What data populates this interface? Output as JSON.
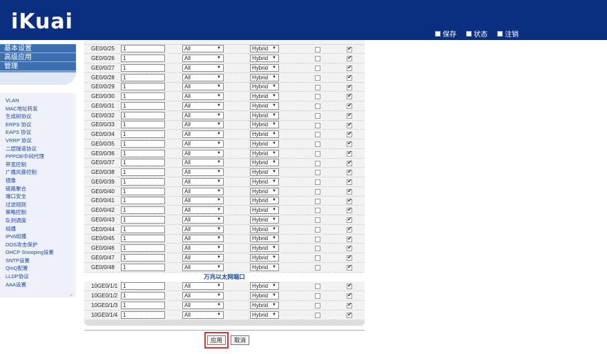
{
  "app": {
    "logo": "iKuai"
  },
  "toplinks": [
    {
      "label": "保存",
      "icon": "save-icon"
    },
    {
      "label": "状态",
      "icon": "status-icon"
    },
    {
      "label": "注销",
      "icon": "logout-icon"
    }
  ],
  "sidebar": {
    "top_menu": [
      "基本设置",
      "高级应用",
      "管理"
    ],
    "items": [
      "VLAN",
      "MAC地址转发",
      "生成树协议",
      "ERPS 协议",
      "EAPS 协议",
      "VRRP 协议",
      "二层隧道协议",
      "PPPOE中间代理",
      "带宽控制",
      "广播风暴控制",
      "镜像",
      "链路聚合",
      "端口安全",
      "过滤规则",
      "策略控制",
      "队列调度",
      "组播",
      "IPv6组播",
      "DOS攻击保护",
      "DHCP Snooping设置",
      "SNTP设置",
      "QinQ配置",
      "LLDP协议",
      "AAA设置"
    ]
  },
  "ports_ge": [
    {
      "name": "GE0/0/25",
      "vlan": "1",
      "allowed": "All",
      "mode": "Hybrid",
      "c1": false,
      "c2": true
    },
    {
      "name": "GE0/0/26",
      "vlan": "1",
      "allowed": "All",
      "mode": "Hybrid",
      "c1": false,
      "c2": true
    },
    {
      "name": "GE0/0/27",
      "vlan": "1",
      "allowed": "All",
      "mode": "Hybrid",
      "c1": false,
      "c2": true
    },
    {
      "name": "GE0/0/28",
      "vlan": "1",
      "allowed": "All",
      "mode": "Hybrid",
      "c1": false,
      "c2": true
    },
    {
      "name": "GE0/0/29",
      "vlan": "1",
      "allowed": "All",
      "mode": "Hybrid",
      "c1": false,
      "c2": true
    },
    {
      "name": "GE0/0/30",
      "vlan": "1",
      "allowed": "All",
      "mode": "Hybrid",
      "c1": false,
      "c2": true
    },
    {
      "name": "GE0/0/31",
      "vlan": "1",
      "allowed": "All",
      "mode": "Hybrid",
      "c1": false,
      "c2": true
    },
    {
      "name": "GE0/0/32",
      "vlan": "1",
      "allowed": "All",
      "mode": "Hybrid",
      "c1": false,
      "c2": true
    },
    {
      "name": "GE0/0/33",
      "vlan": "1",
      "allowed": "All",
      "mode": "Hybrid",
      "c1": false,
      "c2": true
    },
    {
      "name": "GE0/0/34",
      "vlan": "1",
      "allowed": "All",
      "mode": "Hybrid",
      "c1": false,
      "c2": true
    },
    {
      "name": "GE0/0/35",
      "vlan": "1",
      "allowed": "All",
      "mode": "Hybrid",
      "c1": false,
      "c2": true
    },
    {
      "name": "GE0/0/36",
      "vlan": "1",
      "allowed": "All",
      "mode": "Hybrid",
      "c1": false,
      "c2": true
    },
    {
      "name": "GE0/0/37",
      "vlan": "1",
      "allowed": "All",
      "mode": "Hybrid",
      "c1": false,
      "c2": true
    },
    {
      "name": "GE0/0/38",
      "vlan": "1",
      "allowed": "All",
      "mode": "Hybrid",
      "c1": false,
      "c2": true
    },
    {
      "name": "GE0/0/39",
      "vlan": "1",
      "allowed": "All",
      "mode": "Hybrid",
      "c1": false,
      "c2": true
    },
    {
      "name": "GE0/0/40",
      "vlan": "1",
      "allowed": "All",
      "mode": "Hybrid",
      "c1": false,
      "c2": true
    },
    {
      "name": "GE0/0/41",
      "vlan": "1",
      "allowed": "All",
      "mode": "Hybrid",
      "c1": false,
      "c2": true
    },
    {
      "name": "GE0/0/42",
      "vlan": "1",
      "allowed": "All",
      "mode": "Hybrid",
      "c1": false,
      "c2": true
    },
    {
      "name": "GE0/0/43",
      "vlan": "1",
      "allowed": "All",
      "mode": "Hybrid",
      "c1": false,
      "c2": true
    },
    {
      "name": "GE0/0/44",
      "vlan": "1",
      "allowed": "All",
      "mode": "Hybrid",
      "c1": false,
      "c2": true
    },
    {
      "name": "GE0/0/45",
      "vlan": "1",
      "allowed": "All",
      "mode": "Hybrid",
      "c1": false,
      "c2": true
    },
    {
      "name": "GE0/0/46",
      "vlan": "1",
      "allowed": "All",
      "mode": "Hybrid",
      "c1": false,
      "c2": true
    },
    {
      "name": "GE0/0/47",
      "vlan": "1",
      "allowed": "All",
      "mode": "Hybrid",
      "c1": false,
      "c2": true
    },
    {
      "name": "GE0/0/48",
      "vlan": "1",
      "allowed": "All",
      "mode": "Hybrid",
      "c1": false,
      "c2": true
    }
  ],
  "section_10ge_title": "万兆以太网端口",
  "ports_10ge": [
    {
      "name": "10GE0/1/1",
      "vlan": "1",
      "allowed": "All",
      "mode": "Hybrid",
      "c1": false,
      "c2": true
    },
    {
      "name": "10GE0/1/2",
      "vlan": "1",
      "allowed": "All",
      "mode": "Hybrid",
      "c1": false,
      "c2": true
    },
    {
      "name": "10GE0/1/3",
      "vlan": "1",
      "allowed": "All",
      "mode": "Hybrid",
      "c1": false,
      "c2": true
    },
    {
      "name": "10GE0/1/4",
      "vlan": "1",
      "allowed": "All",
      "mode": "Hybrid",
      "c1": false,
      "c2": true
    }
  ],
  "buttons": {
    "apply": "应用",
    "cancel": "取消"
  }
}
